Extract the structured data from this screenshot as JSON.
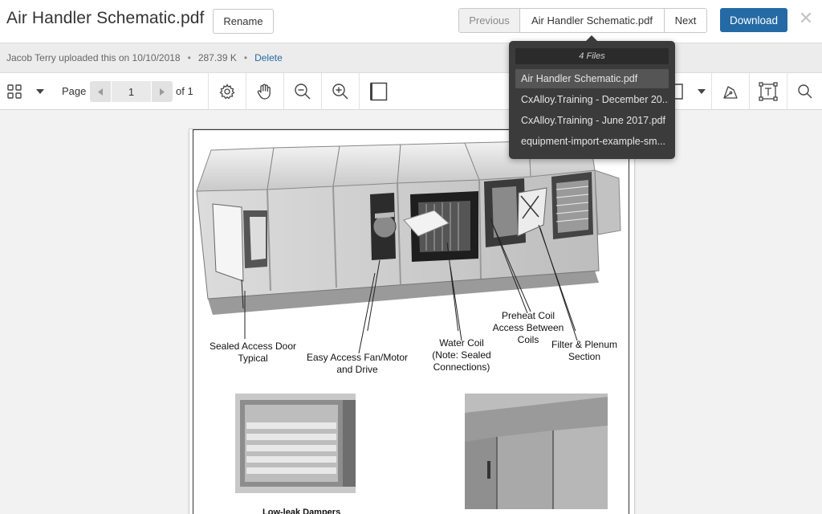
{
  "header": {
    "title": "Air Handler Schematic.pdf",
    "rename_label": "Rename",
    "prev_label": "Previous",
    "current_file": "Air Handler Schematic.pdf",
    "next_label": "Next",
    "download_label": "Download",
    "close_icon": "close-icon"
  },
  "info": {
    "uploader_text": "Jacob Terry uploaded this on 10/10/2018",
    "separator": "•",
    "file_size": "287.39 K",
    "delete_label": "Delete"
  },
  "toolbar": {
    "page_label": "Page",
    "page_value": "1",
    "of_label": "of 1",
    "icons": [
      "grid-icon",
      "chevron-down-icon",
      "gear-icon",
      "hand-pan-icon",
      "zoom-out-icon",
      "zoom-in-icon",
      "page-frame-icon",
      "rectangle-select-icon",
      "chevron-down-icon",
      "signature-icon",
      "text-box-icon",
      "search-icon"
    ]
  },
  "file_dropdown": {
    "heading": "4 Files",
    "items": [
      "Air Handler Schematic.pdf",
      "CxAlloy.Training - December 20...",
      "CxAlloy.Training - June 2017.pdf",
      "equipment-import-example-sm..."
    ],
    "active_index": 0
  },
  "document": {
    "callouts": [
      "Sealed Access Door\nTypical",
      "Easy Access Fan/Motor\nand Drive",
      "Water Coil\n(Note: Sealed\nConnections)",
      "Preheat Coil\nAccess Between\nCoils",
      "Filter & Plenum\nSection"
    ],
    "caption": "Low-leak Dampers"
  },
  "colors": {
    "accent": "#246aa5",
    "dropdown_bg": "#3b3b3b"
  }
}
